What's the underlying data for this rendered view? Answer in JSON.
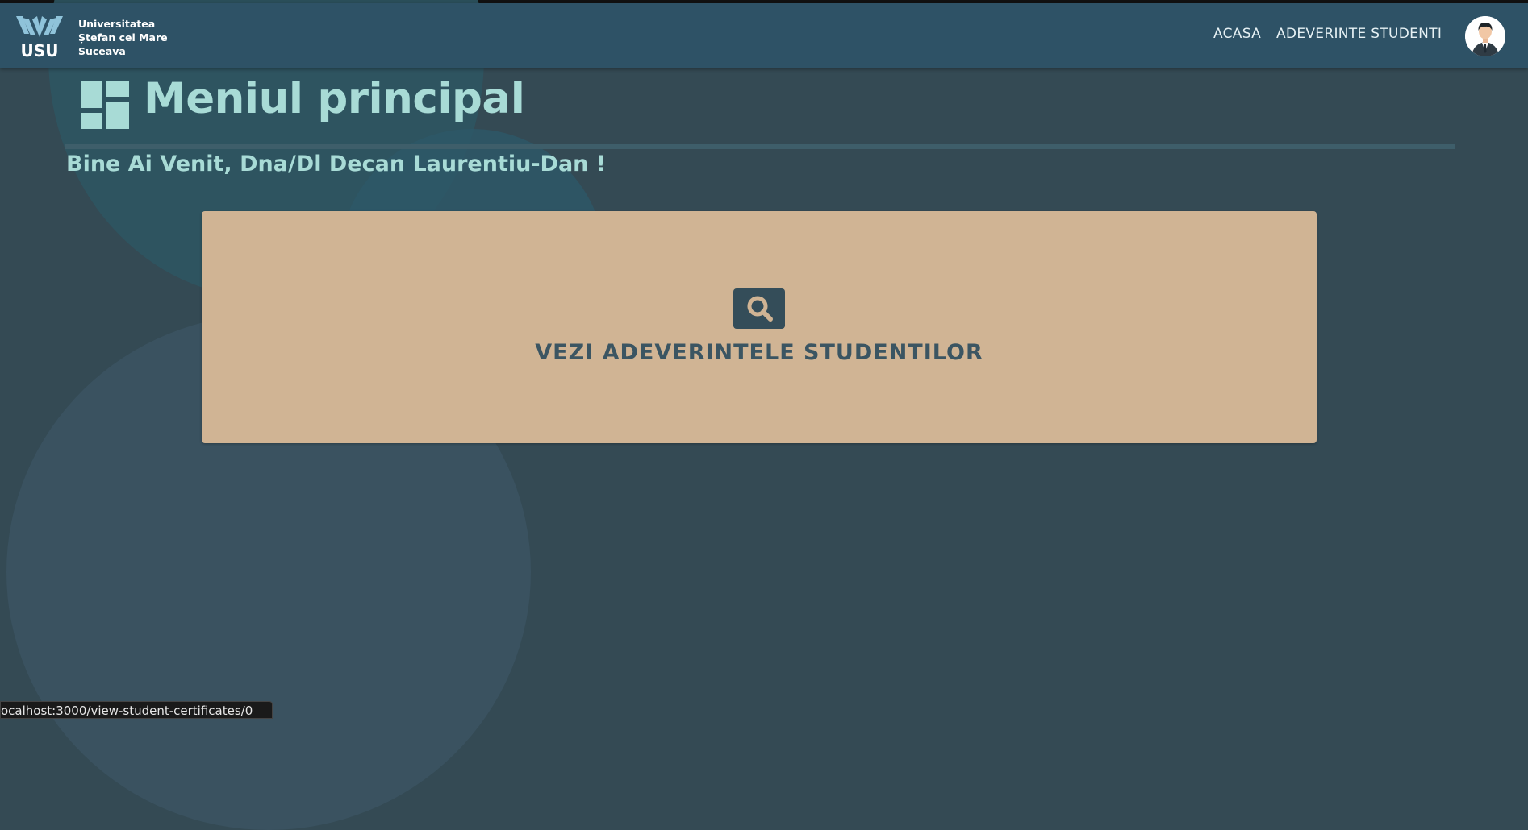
{
  "header": {
    "university_lines": [
      "Universitatea",
      "Ștefan cel Mare",
      "Suceava"
    ],
    "logo_text": "USU",
    "nav": {
      "acasa": "ACASA",
      "adeverinte": "ADEVERINTE STUDENTI"
    },
    "avatar_icon": "user-avatar-icon"
  },
  "main": {
    "title": "Meniul principal",
    "title_icon": "dashboard-icon",
    "welcome": "Bine Ai Venit, Dna/Dl Decan Laurentiu-Dan !",
    "card": {
      "label": "VEZI ADEVERINTELE STUDENTILOR",
      "icon": "search-icon"
    }
  },
  "status_bar": {
    "url": "ocalhost:3000/view-student-certificates/0"
  },
  "colors": {
    "navbar": "#2e5266",
    "background": "#344a54",
    "accent_text": "#a8dbd6",
    "card": "#d0b494",
    "card_text": "#3b5562"
  }
}
